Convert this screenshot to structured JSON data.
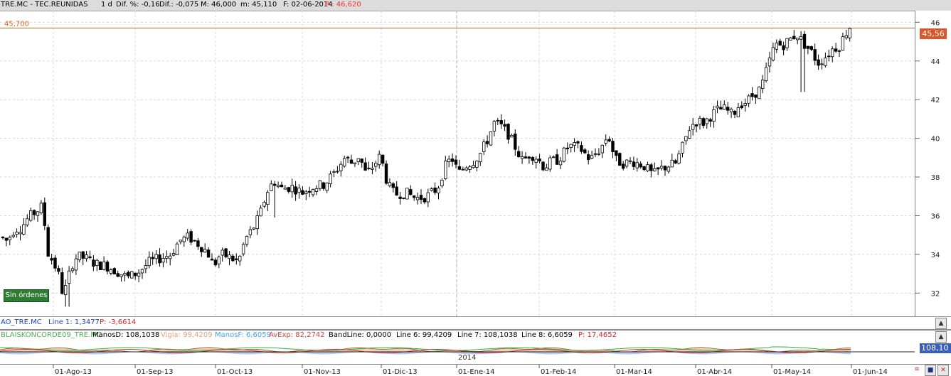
{
  "header": {
    "symbol": "TRE.MC - TEC.REUNIDAS",
    "period": "1 d",
    "dif_pct": "Dif. %: -0,16",
    "dif": "Dif.: -0,075",
    "max": "M: 46,000",
    "min": "m: 45,110",
    "date": "F: 02-06-2014",
    "price": "P : 46,620",
    "price_color": "#ff3030"
  },
  "chart_data": {
    "type": "candlestick",
    "y_ticks": [
      "46",
      "44",
      "42",
      "40",
      "38",
      "36",
      "34",
      "32"
    ],
    "ylim": [
      30.8,
      46.6
    ],
    "x_tick_labels": [
      "01-Ago-13",
      "01-Sep-13",
      "01-Oct-13",
      "01-Nov-13",
      "01-Dic-13",
      "01-Ene-14",
      "01-Feb-14",
      "01-Mar-14",
      "01-Abr-14",
      "01-May-14",
      "01-Jun-14"
    ],
    "year_label": "2014",
    "reference_line": {
      "label": "45,700",
      "value": 45.7,
      "color": "#e06020"
    },
    "last_price_label": "45,56",
    "anchors": [
      [
        0,
        34.9
      ],
      [
        10,
        34.7
      ],
      [
        20,
        35.3
      ],
      [
        30,
        35.4
      ],
      [
        40,
        35.9
      ],
      [
        50,
        36.2
      ],
      [
        60,
        36.5
      ],
      [
        67,
        34.1
      ],
      [
        75,
        33.6
      ],
      [
        82,
        33.0
      ],
      [
        88,
        32.0
      ],
      [
        93,
        32.3
      ],
      [
        100,
        33.4
      ],
      [
        108,
        33.9
      ],
      [
        120,
        33.8
      ],
      [
        135,
        33.5
      ],
      [
        150,
        33.4
      ],
      [
        165,
        33.1
      ],
      [
        180,
        32.8
      ],
      [
        195,
        33.1
      ],
      [
        210,
        33.6
      ],
      [
        225,
        33.8
      ],
      [
        240,
        34.0
      ],
      [
        252,
        34.7
      ],
      [
        265,
        34.9
      ],
      [
        280,
        34.5
      ],
      [
        292,
        34.1
      ],
      [
        300,
        33.4
      ],
      [
        310,
        34.0
      ],
      [
        320,
        33.9
      ],
      [
        335,
        33.6
      ],
      [
        345,
        34.8
      ],
      [
        355,
        35.3
      ],
      [
        365,
        36.0
      ],
      [
        375,
        37.2
      ],
      [
        385,
        37.8
      ],
      [
        395,
        37.4
      ],
      [
        410,
        37.5
      ],
      [
        425,
        37.2
      ],
      [
        440,
        37.5
      ],
      [
        455,
        37.6
      ],
      [
        470,
        38.2
      ],
      [
        485,
        39.0
      ],
      [
        495,
        38.7
      ],
      [
        505,
        39.1
      ],
      [
        515,
        38.1
      ],
      [
        525,
        38.6
      ],
      [
        535,
        39.1
      ],
      [
        545,
        37.6
      ],
      [
        555,
        37.1
      ],
      [
        570,
        37.2
      ],
      [
        585,
        36.9
      ],
      [
        600,
        37.0
      ],
      [
        615,
        37.4
      ],
      [
        625,
        38.5
      ],
      [
        635,
        39.0
      ],
      [
        645,
        38.2
      ],
      [
        655,
        38.6
      ],
      [
        665,
        38.8
      ],
      [
        675,
        39.2
      ],
      [
        685,
        39.9
      ],
      [
        695,
        40.8
      ],
      [
        705,
        40.6
      ],
      [
        715,
        40.2
      ],
      [
        725,
        39.5
      ],
      [
        735,
        38.8
      ],
      [
        745,
        39.2
      ],
      [
        755,
        39.0
      ],
      [
        765,
        38.5
      ],
      [
        775,
        38.8
      ],
      [
        785,
        38.9
      ],
      [
        800,
        39.6
      ],
      [
        815,
        39.5
      ],
      [
        830,
        38.9
      ],
      [
        845,
        39.5
      ],
      [
        855,
        40.2
      ],
      [
        865,
        38.9
      ],
      [
        875,
        38.7
      ],
      [
        890,
        38.8
      ],
      [
        905,
        38.6
      ],
      [
        918,
        38.1
      ],
      [
        928,
        38.4
      ],
      [
        940,
        38.6
      ],
      [
        950,
        38.7
      ],
      [
        960,
        39.6
      ],
      [
        970,
        40.6
      ],
      [
        980,
        40.9
      ],
      [
        990,
        40.8
      ],
      [
        1000,
        41.2
      ],
      [
        1010,
        41.5
      ],
      [
        1020,
        41.5
      ],
      [
        1030,
        41.2
      ],
      [
        1040,
        41.8
      ],
      [
        1050,
        41.9
      ],
      [
        1060,
        42.3
      ],
      [
        1070,
        42.6
      ],
      [
        1080,
        43.8
      ],
      [
        1090,
        44.9
      ],
      [
        1100,
        44.8
      ],
      [
        1110,
        45.1
      ],
      [
        1120,
        45.4
      ],
      [
        1130,
        44.9
      ],
      [
        1140,
        44.5
      ],
      [
        1150,
        43.9
      ],
      [
        1160,
        44.2
      ],
      [
        1170,
        44.6
      ],
      [
        1180,
        44.8
      ],
      [
        1190,
        45.5
      ],
      [
        1197,
        45.9
      ]
    ]
  },
  "indicator1": {
    "name": "AO_TRE.MC",
    "line1": "Line 1: 1,3477",
    "p": "P: -3,6614",
    "name_color": "#2040c0",
    "p_color": "#e02020"
  },
  "indicator2": {
    "name": "BLAISKONCORDE09_TRE.MC",
    "manosd": "ManosD: 108,1038",
    "vigia": "Vigia: 99,4209",
    "manosf": "ManosF: 6,6059",
    "avexp": "AvExp: 82,2742",
    "bandline": "BandLine: 0,0000",
    "line6": "Line 6: 99,4209",
    "line7": "Line 7: 108,1038",
    "line8": "Line 8: 6,6059",
    "p": "P: 17,4652",
    "value_label": "108,10",
    "name_color": "#4caf50",
    "vigia_color": "#e0a080",
    "manosf_color": "#40a0ff",
    "avexp_color": "#d04040",
    "p_color": "#e02020"
  },
  "status": {
    "no_orders": "Sin órdenes"
  }
}
